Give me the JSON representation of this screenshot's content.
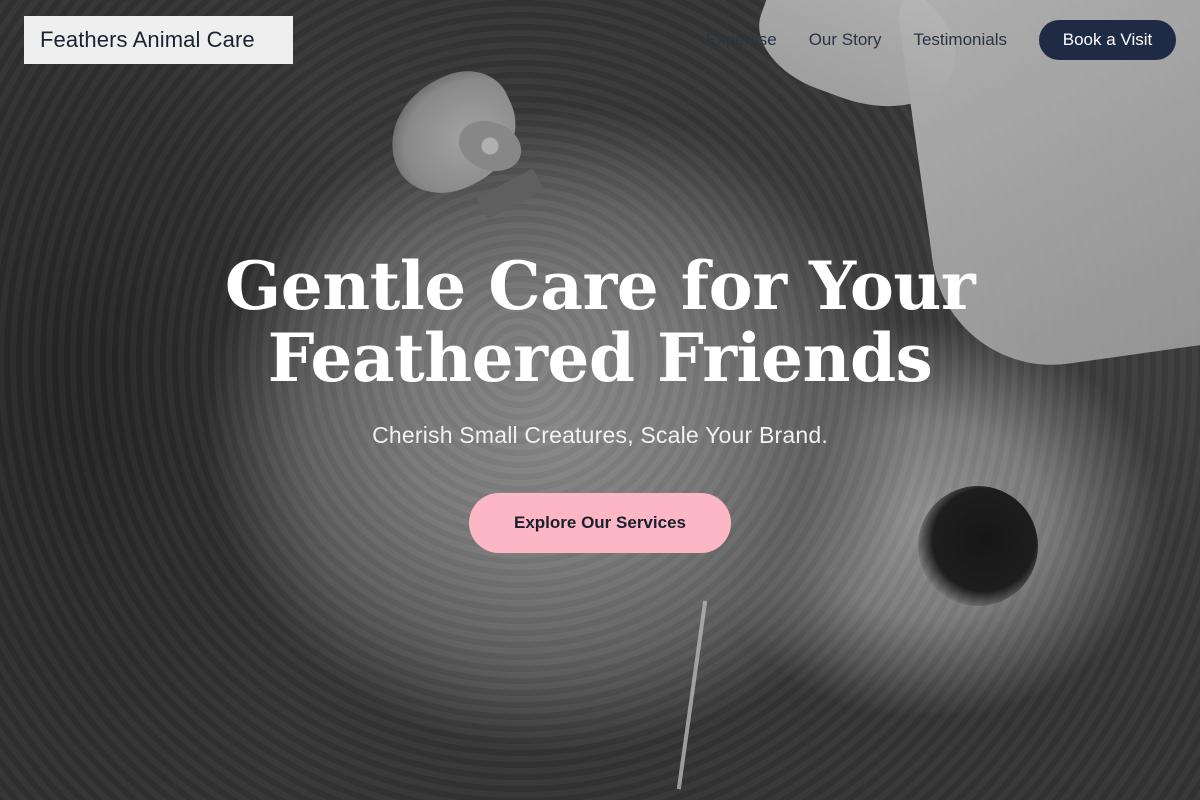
{
  "brand": {
    "name": "Feathers Animal Care"
  },
  "nav": {
    "links": [
      "Expertise",
      "Our Story",
      "Testimonials"
    ],
    "cta_label": "Book a Visit"
  },
  "hero": {
    "headline_line1": "Gentle Care for Your",
    "headline_line2": "Feathered Friends",
    "subheadline": "Cherish Small Creatures, Scale Your Brand.",
    "cta_label": "Explore Our Services",
    "background_image": "grayscale-sheep-photo"
  },
  "colors": {
    "brand_box_bg": "#efefef",
    "nav_text": "#2b3346",
    "nav_button_bg": "#1f2a44",
    "cta_bg": "#fdb6c4",
    "headline_text": "#ffffff"
  }
}
